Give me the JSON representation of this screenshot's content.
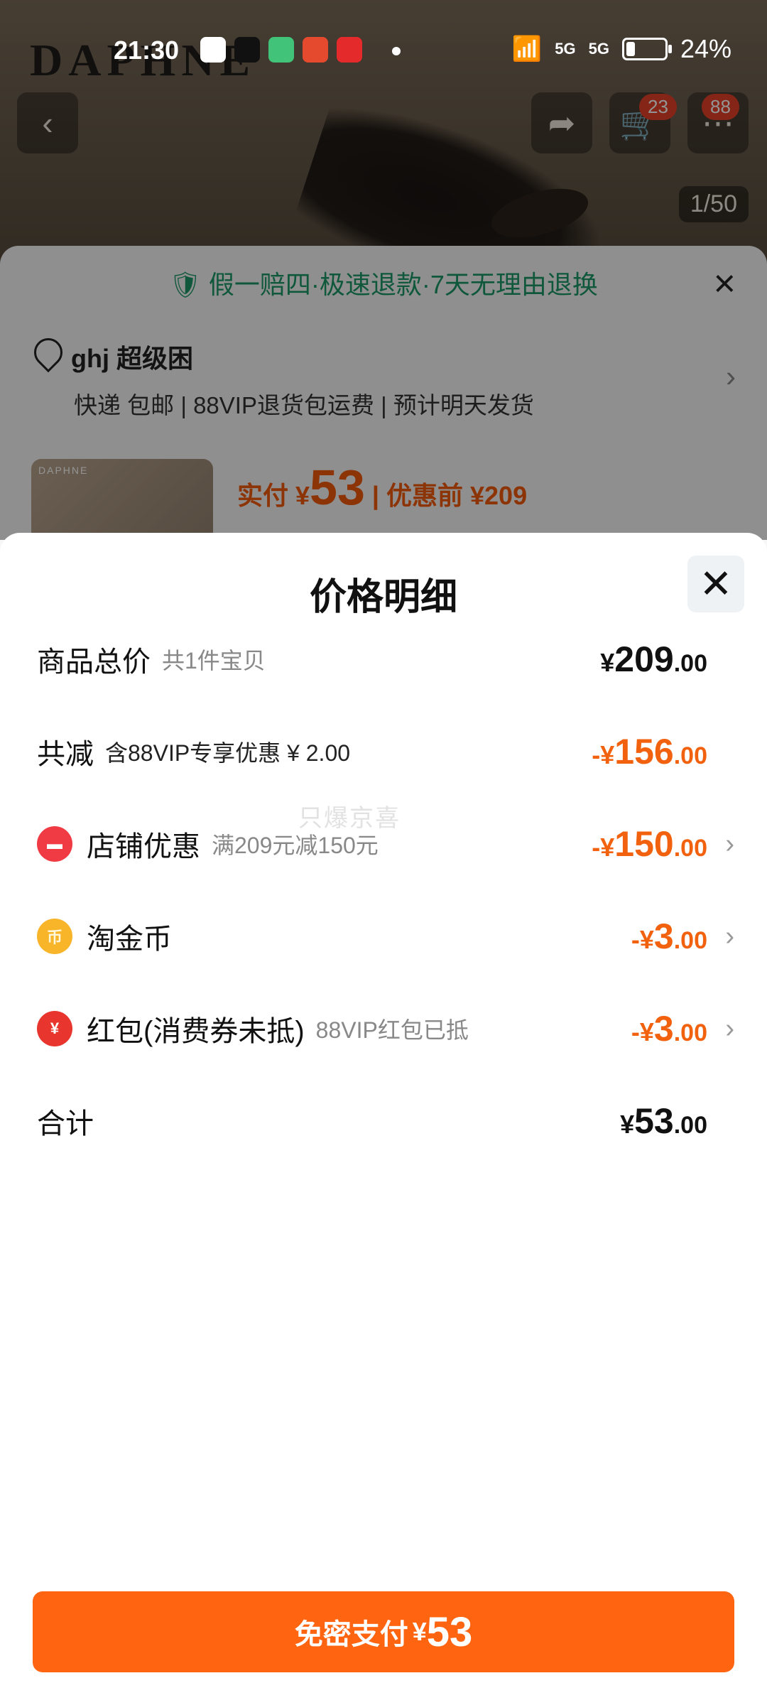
{
  "status_bar": {
    "time": "21:30",
    "network_1": "5G",
    "network_2": "5G",
    "battery": "24%"
  },
  "background": {
    "brand": "DAPHNE",
    "cart_badge": "23",
    "more_badge": "88",
    "image_counter": "1/50",
    "guarantee": "假一赔四·极速退款·7天无理由退换",
    "address_name": "ghj 超级困",
    "address_details": "快递 包邮 | 88VIP退货包运费 | 预计明天发货",
    "product_brand": "DAPHNE",
    "price_prefix": "实付 ¥",
    "price_value": "53",
    "price_original": "| 优惠前 ¥209"
  },
  "sheet": {
    "title": "价格明细",
    "watermark": "只爆京喜",
    "rows": [
      {
        "label": "商品总价",
        "sub": "共1件宝贝",
        "currency": "¥",
        "int": "209",
        "dec": ".00",
        "color": "#111111"
      },
      {
        "label": "共减",
        "sub": "含88VIP专享优惠 ¥ 2.00",
        "currency": "-¥",
        "int": "156",
        "dec": ".00",
        "color": "#f2620e"
      },
      {
        "label": "店铺优惠",
        "sub": "满209元减150元",
        "currency": "-¥",
        "int": "150",
        "dec": ".00",
        "icon": "shop-icon",
        "color": "#f2620e"
      },
      {
        "label": "淘金币",
        "sub": "",
        "currency": "-¥",
        "int": "3",
        "dec": ".00",
        "icon": "coin-icon",
        "color": "#f2620e"
      },
      {
        "label": "红包(消费券未抵)",
        "sub": "88VIP红包已抵",
        "currency": "-¥",
        "int": "3",
        "dec": ".00",
        "icon": "red-packet-icon",
        "color": "#f2620e"
      },
      {
        "label": "合计",
        "sub": "",
        "currency": "¥",
        "int": "53",
        "dec": ".00",
        "color": "#111111"
      }
    ]
  },
  "pay_button": {
    "label": "免密支付",
    "currency": "¥",
    "amount": "53"
  }
}
